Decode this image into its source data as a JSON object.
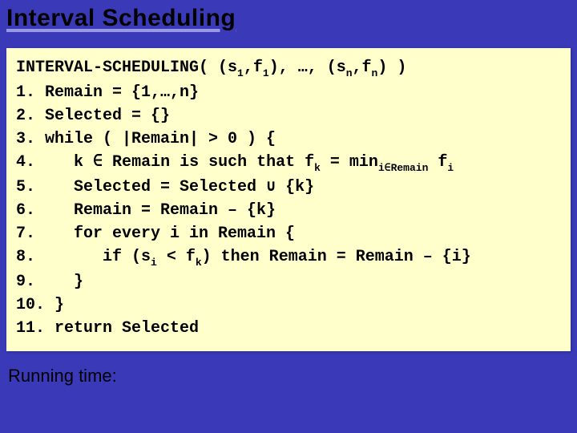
{
  "title": "Interval Scheduling",
  "code": {
    "sig_a": "INTERVAL-SCHEDULING( (s",
    "sig_b": ",f",
    "sig_c": "), …, (s",
    "sig_d": ",f",
    "sig_e": ") )",
    "sub1": "1",
    "subn": "n",
    "l1": "1. Remain = {1,…,n}",
    "l2": "2. Selected = {}",
    "l3": "3. while ( |Remain| > 0 ) {",
    "l4a": "4.    k ∈ Remain is such that f",
    "l4b": " = min",
    "l4c": " f",
    "sub_k": "k",
    "sub_iR": "i∈Remain",
    "sub_i": "i",
    "l5": "5.    Selected = Selected ∪ {k}",
    "l6": "6.    Remain = Remain – {k}",
    "l7": "7.    for every i in Remain {",
    "l8a": "8.       if (s",
    "l8b": " < f",
    "l8c": ") then Remain = Remain – {i}",
    "l9": "9.    }",
    "l10": "10. }",
    "l11": "11. return Selected"
  },
  "runtime_label": "Running time:"
}
